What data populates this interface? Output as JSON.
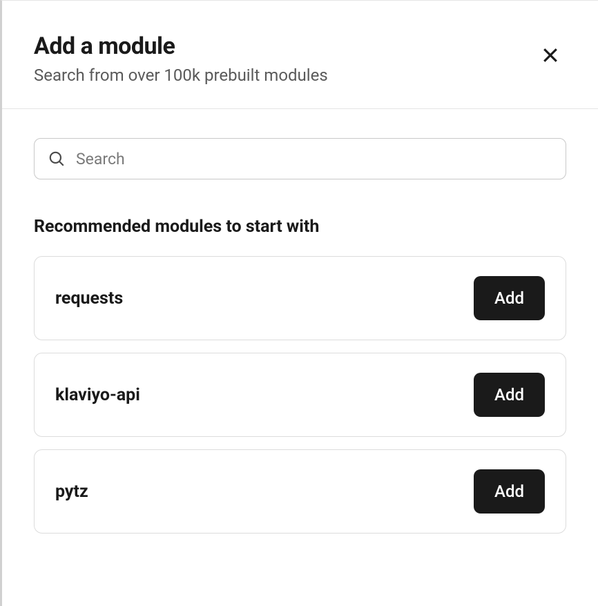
{
  "header": {
    "title": "Add a module",
    "subtitle": "Search from over 100k prebuilt modules"
  },
  "search": {
    "placeholder": "Search",
    "value": ""
  },
  "recommended": {
    "heading": "Recommended modules to start with",
    "add_label": "Add",
    "modules": [
      {
        "name": "requests"
      },
      {
        "name": "klaviyo-api"
      },
      {
        "name": "pytz"
      }
    ]
  }
}
